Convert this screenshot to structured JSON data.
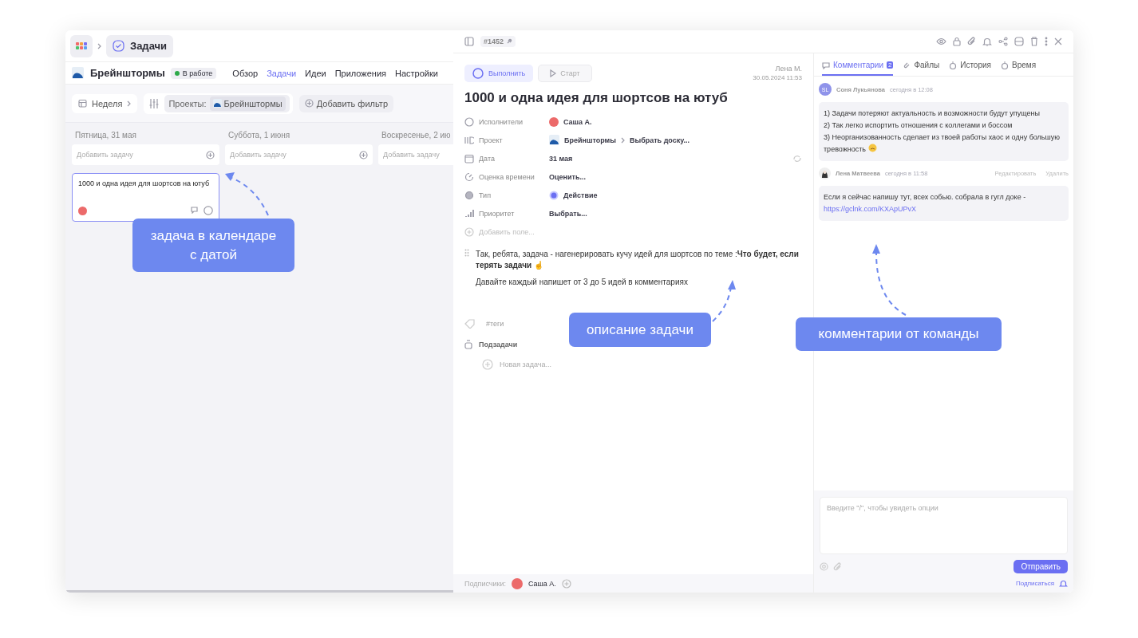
{
  "breadcrumb": {
    "title": "Задачи"
  },
  "project": {
    "name": "Брейнштормы",
    "status": "В работе",
    "nav": [
      {
        "label": "Обзор",
        "selected": false
      },
      {
        "label": "Задачи",
        "selected": true
      },
      {
        "label": "Идеи",
        "selected": false
      },
      {
        "label": "Приложения",
        "selected": false
      },
      {
        "label": "Настройки",
        "selected": false
      }
    ]
  },
  "filters": {
    "period": "Неделя",
    "projects_label": "Проекты:",
    "project": "Брейнштормы",
    "add_filter": "Добавить фильтр"
  },
  "calendar": {
    "days": [
      {
        "title": "Пятница, 31 мая",
        "placeholder": "Добавить задачу",
        "tasks": [
          {
            "title": "1000 и одна идея для шортсов на ютуб"
          }
        ]
      },
      {
        "title": "Суббота, 1 июня",
        "placeholder": "Добавить задачу"
      },
      {
        "title": "Воскресенье, 2 ию",
        "placeholder": "Добавить задачу"
      }
    ]
  },
  "task": {
    "id": "#1452",
    "complete": "Выполнить",
    "start": "Старт",
    "author": "Лена М.",
    "created": "30.05.2024 11:53",
    "title": "1000 и одна идея для шортсов на ютуб",
    "fields": [
      {
        "kind": "assignee",
        "label": "Исполнители",
        "value": "Саша А."
      },
      {
        "kind": "project",
        "label": "Проект",
        "value": "Брейнштормы",
        "board": "Выбрать доску..."
      },
      {
        "kind": "date",
        "label": "Дата",
        "value": "31 мая"
      },
      {
        "kind": "estimate",
        "label": "Оценка времени",
        "value": "Оценить..."
      },
      {
        "kind": "type",
        "label": "Тип",
        "value": "Действие"
      },
      {
        "kind": "priority",
        "label": "Приоритет",
        "value": "Выбрать..."
      }
    ],
    "add_field": "Добавить поле...",
    "description": [
      "Так, ребята, задача - нагенерировать кучу идей для шортсов по теме :**Что будет, если терять задачи** ☝",
      "Давайте каждый напишет от 3 до 5 идей в комментариях"
    ],
    "tags": "#теги",
    "subtasks": "Подзадачи",
    "new_subtask": "Новая задача...",
    "subscribers_label": "Подписчики:",
    "subscribers": [
      "Саша А."
    ]
  },
  "comments_panel": {
    "tabs": [
      {
        "label": "Комментарии",
        "count": "2",
        "selected": true
      },
      {
        "label": "Файлы",
        "selected": false
      },
      {
        "label": "История",
        "selected": false
      },
      {
        "label": "Время",
        "selected": false
      }
    ],
    "comments": [
      {
        "author": "Соня Лукьянова",
        "initials": "SL",
        "time": "сегодня в 12:08",
        "lines": [
          "1) Задачи потеряют актуальность и возможности будут упущены",
          "2) Так легко испортить отношения с коллегами и боссом",
          "3) Неорганизованность сделает из твоей работы хаос и одну большую тревожность"
        ]
      },
      {
        "author": "Лена Матвеева",
        "time": "сегодня в 11:58",
        "actions": [
          "Редактировать",
          "Удалить"
        ],
        "lines": [
          "Если я сейчас напишу тут, всех собью. собрала в гугл доке - "
        ],
        "link": "https://gclnk.com/KXApUPvX"
      }
    ],
    "composer": {
      "placeholder": "Введите \"/\", чтобы увидеть опции",
      "send": "Отправить",
      "subscribe": "Подписаться"
    }
  },
  "callouts": [
    {
      "text": "задача в календаре с датой"
    },
    {
      "text": "описание задачи"
    },
    {
      "text": "комментарии от команды"
    }
  ]
}
